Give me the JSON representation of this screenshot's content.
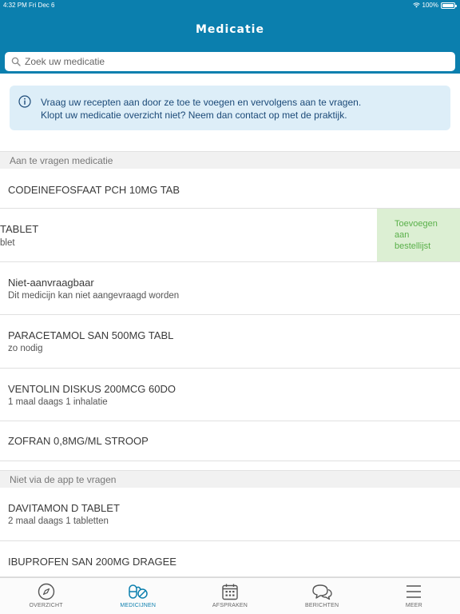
{
  "status_bar": {
    "time": "4:32 PM",
    "date": "Fri Dec 6",
    "battery": "100%"
  },
  "header": {
    "title": "Medicatie"
  },
  "search": {
    "placeholder": "Zoek uw medicatie"
  },
  "info": {
    "line1": "Vraag uw recepten aan door ze toe te voegen en vervolgens aan te vragen.",
    "line2": "Klopt uw medicatie overzicht niet? Neem dan contact op met de praktijk."
  },
  "sections": [
    {
      "header": "Aan te vragen medicatie",
      "items": [
        {
          "name": "CODEINEFOSFAAT PCH 10MG TAB",
          "detail": ""
        },
        {
          "name": "TABLET",
          "detail": "blet",
          "swipe_action": [
            "Toevoegen",
            "aan",
            "bestellijst"
          ]
        },
        {
          "name": "Niet-aanvraagbaar",
          "detail": "Dit medicijn kan niet aangevraagd worden"
        },
        {
          "name": "PARACETAMOL SAN 500MG TABL",
          "detail": "zo nodig"
        },
        {
          "name": "VENTOLIN DISKUS 200MCG 60DO",
          "detail": "1 maal daags 1 inhalatie"
        },
        {
          "name": "ZOFRAN 0,8MG/ML STROOP",
          "detail": ""
        }
      ]
    },
    {
      "header": "Niet via de app te vragen",
      "items": [
        {
          "name": "DAVITAMON D TABLET",
          "detail": "2 maal daags 1 tabletten"
        },
        {
          "name": "IBUPROFEN SAN 200MG DRAGEE",
          "detail": ""
        }
      ]
    }
  ],
  "tabbar": {
    "active": "MEDICIJNEN",
    "items": [
      {
        "label": "OVERZICHT",
        "icon": "compass-icon"
      },
      {
        "label": "MEDICIJNEN",
        "icon": "pills-icon"
      },
      {
        "label": "AFSPRAKEN",
        "icon": "calendar-icon"
      },
      {
        "label": "BERICHTEN",
        "icon": "chat-bubbles-icon"
      },
      {
        "label": "MEER",
        "icon": "menu-icon"
      }
    ]
  },
  "colors": {
    "brand": "#0b7fae",
    "info_background": "#ddeef8",
    "info_text": "#1c4a78",
    "swipe_action_background": "#dcefd3",
    "swipe_action_text": "#5ab04a"
  }
}
